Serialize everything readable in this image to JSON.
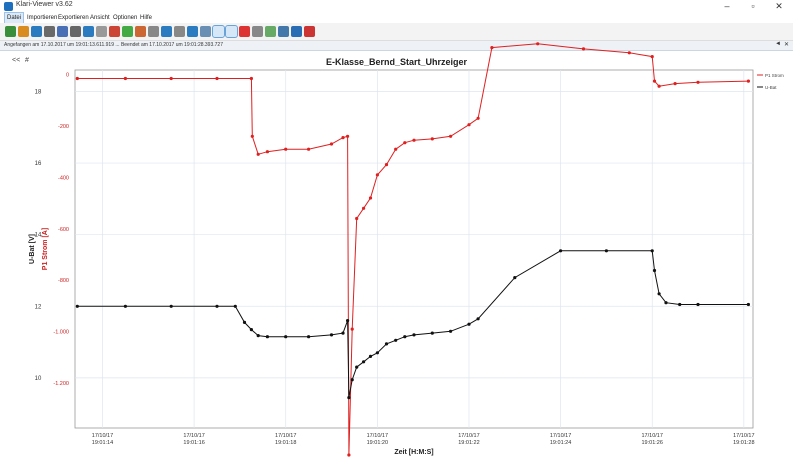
{
  "window": {
    "title": "Klari-Viewer v3.62",
    "minimize": "–",
    "maximize": "▫",
    "close": "✕"
  },
  "menu": [
    "Datei",
    "Importieren",
    "Exportieren",
    "Ansicht",
    "Optionen",
    "Hilfe"
  ],
  "toolbar_icons": [
    "open-icon",
    "refresh-icon",
    "export-icon",
    "print-icon",
    "settings-icon",
    "cut-icon",
    "copy-icon",
    "paste-icon",
    "report-icon",
    "graph-icon",
    "table-icon",
    "zoom-icon",
    "filter-icon",
    "sum-icon",
    "chart-icon",
    "funnel-icon",
    "cursor-icon",
    "curve-icon",
    "marker-icon",
    "scale-icon",
    "tools-icon",
    "calc-icon",
    "help-icon",
    "stop-icon"
  ],
  "status": {
    "text": "Angefangen am 17.10.2017 um 19:01:13.611.919 ... Beendet am 17.10.2017 um 19:01:28.393.727",
    "pin": "◄",
    "close": "✕"
  },
  "chart_controls": {
    "collapse": "<<",
    "grid": "#"
  },
  "chart_data": {
    "type": "line",
    "title": "E-Klasse_Bernd_Start_Uhrzeiger",
    "xlabel": "Zeit [H:M:S]",
    "ylabel_left": "U-Bat [V]",
    "ylabel_right_series": "P1 Strom [A]",
    "xlim": [
      13.4,
      28.2
    ],
    "x_ticks": [
      {
        "t": 14,
        "date": "17/10/17",
        "time": "19:01:14"
      },
      {
        "t": 16,
        "date": "17/10/17",
        "time": "19:01:16"
      },
      {
        "t": 18,
        "date": "17/10/17",
        "time": "19:01:18"
      },
      {
        "t": 20,
        "date": "17/10/17",
        "time": "19:01:20"
      },
      {
        "t": 22,
        "date": "17/10/17",
        "time": "19:01:22"
      },
      {
        "t": 24,
        "date": "17/10/17",
        "time": "19:01:24"
      },
      {
        "t": 26,
        "date": "17/10/17",
        "time": "19:01:26"
      },
      {
        "t": 28,
        "date": "17/10/17",
        "time": "19:01:28"
      }
    ],
    "y_left": {
      "label": "U-Bat [V]",
      "ticks": [
        "18",
        "16",
        "14",
        "12",
        "10"
      ],
      "range": [
        8.6,
        18.6
      ]
    },
    "y_right": {
      "label": "P1 Strom [A]",
      "ticks": [
        "0",
        "-200",
        "-400",
        "-600",
        "-800",
        "-1.000",
        "-1.200"
      ],
      "range": [
        -1375,
        18
      ]
    },
    "legend": {
      "position": "top-right",
      "entries": [
        "P1 Strom",
        "U-Bat"
      ]
    },
    "grid": true,
    "series": [
      {
        "name": "P1 Strom",
        "axis": "right",
        "color": "#e02020",
        "x": [
          13.45,
          14.5,
          15.5,
          16.5,
          17.25,
          17.27,
          17.4,
          17.6,
          18.0,
          18.5,
          19.0,
          19.25,
          19.35,
          19.38,
          19.45,
          19.55,
          19.7,
          19.85,
          20.0,
          20.2,
          20.4,
          20.6,
          20.8,
          21.2,
          21.6,
          22.0,
          22.2,
          22.5,
          23.5,
          24.5,
          25.5,
          26.0,
          26.05,
          26.15,
          26.5,
          27.0,
          28.1
        ],
        "y": [
          -15,
          -15,
          -15,
          -15,
          -15,
          -240,
          -310,
          -300,
          -290,
          -290,
          -270,
          -245,
          -240,
          -1480,
          -990,
          -560,
          -520,
          -480,
          -390,
          -350,
          -290,
          -265,
          -255,
          -250,
          -240,
          -195,
          -170,
          105,
          120,
          100,
          85,
          70,
          -25,
          -45,
          -35,
          -30,
          -25
        ]
      },
      {
        "name": "U-Bat",
        "axis": "left",
        "color": "#111111",
        "x": [
          13.45,
          14.5,
          15.5,
          16.5,
          16.9,
          17.1,
          17.25,
          17.4,
          17.6,
          18.0,
          18.5,
          19.0,
          19.25,
          19.35,
          19.38,
          19.45,
          19.55,
          19.7,
          19.85,
          20.0,
          20.2,
          20.4,
          20.6,
          20.8,
          21.2,
          21.6,
          22.0,
          22.2,
          23.0,
          24.0,
          25.0,
          26.0,
          26.05,
          26.15,
          26.3,
          26.6,
          27.0,
          28.1
        ],
        "y": [
          12.0,
          12.0,
          12.0,
          12.0,
          12.0,
          11.55,
          11.35,
          11.18,
          11.15,
          11.15,
          11.15,
          11.2,
          11.25,
          11.6,
          9.45,
          9.95,
          10.3,
          10.45,
          10.6,
          10.7,
          10.95,
          11.05,
          11.15,
          11.2,
          11.25,
          11.3,
          11.5,
          11.65,
          12.8,
          13.55,
          13.55,
          13.55,
          13.0,
          12.35,
          12.1,
          12.05,
          12.05,
          12.05
        ]
      }
    ]
  }
}
